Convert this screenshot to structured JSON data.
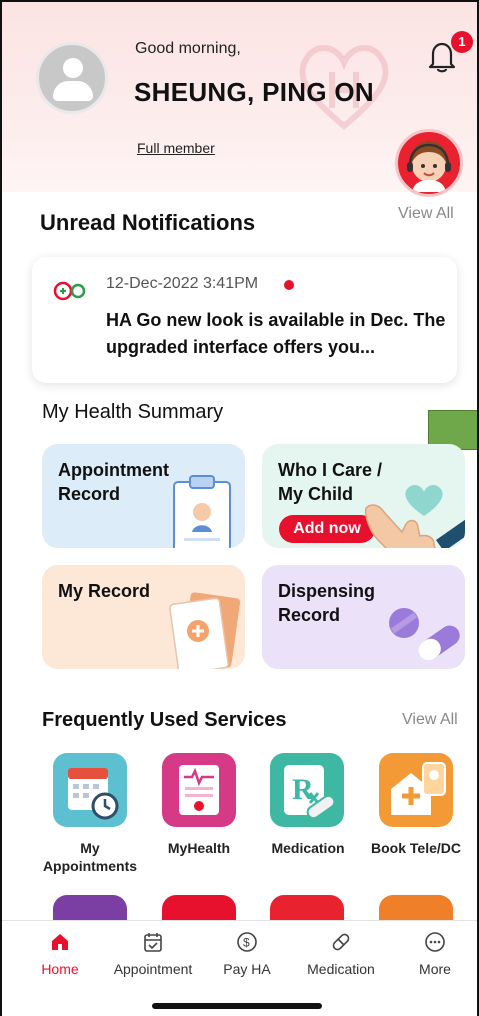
{
  "header": {
    "greeting": "Good morning,",
    "user_name": "SHEUNG, PING ON",
    "membership": "Full member",
    "notification_count": "1"
  },
  "notifications": {
    "title": "Unread Notifications",
    "view_all": "View All",
    "item": {
      "date": "12-Dec-2022  3:41PM",
      "text": "HA Go new look is available in Dec. The upgraded interface offers you..."
    }
  },
  "health_summary": {
    "title": "My Health Summary",
    "cards": [
      {
        "label": "Appointment Record"
      },
      {
        "label": "Who I Care / My Child",
        "button": "Add now"
      },
      {
        "label": "My Record"
      },
      {
        "label": "Dispensing Record"
      }
    ]
  },
  "services": {
    "title": "Frequently Used Services",
    "view_all": "View All",
    "items": [
      {
        "label": "My Appointments",
        "icon": "calendar-clock-icon"
      },
      {
        "label": "MyHealth",
        "icon": "health-record-icon"
      },
      {
        "label": "Medication",
        "icon": "rx-icon"
      },
      {
        "label": "Book Tele/DC",
        "icon": "clinic-icon"
      }
    ]
  },
  "bottom_nav": {
    "items": [
      {
        "label": "Home",
        "icon": "home-icon",
        "active": true
      },
      {
        "label": "Appointment",
        "icon": "calendar-icon"
      },
      {
        "label": "Pay HA",
        "icon": "dollar-icon"
      },
      {
        "label": "Medication",
        "icon": "pill-icon"
      },
      {
        "label": "More",
        "icon": "more-icon"
      }
    ]
  },
  "colors": {
    "brand_red": "#e8112d",
    "header_bg": "#fbe3e3",
    "appointment_card": "#dcecf8",
    "care_card": "#e4f6ef",
    "record_card": "#fde7d6",
    "dispensing_card": "#ebe1f9"
  }
}
